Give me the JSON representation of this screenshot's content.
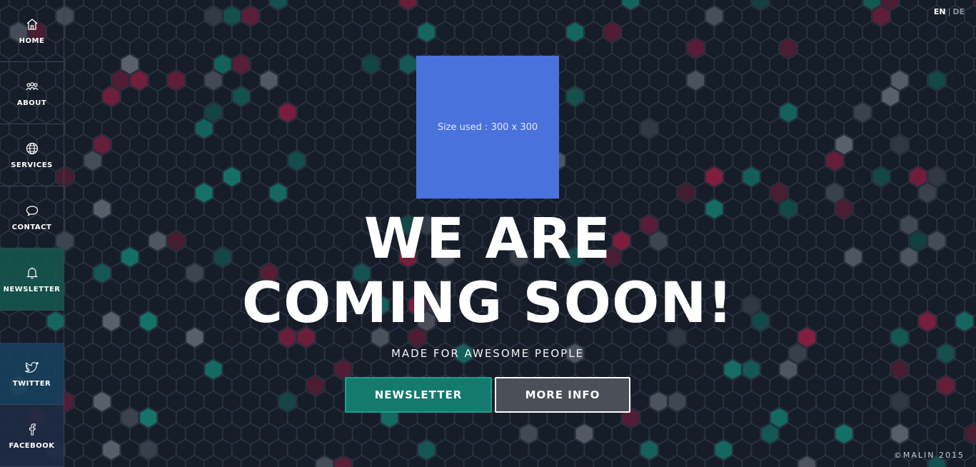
{
  "nav": [
    {
      "label": "HOME",
      "icon": "home-icon"
    },
    {
      "label": "ABOUT",
      "icon": "team-icon"
    },
    {
      "label": "SERVICES",
      "icon": "globe-icon"
    },
    {
      "label": "CONTACT",
      "icon": "chat-bubble-icon"
    },
    {
      "label": "NEWSLETTER",
      "icon": "bell-icon"
    },
    {
      "label": "TWITTER",
      "icon": "twitter-icon"
    },
    {
      "label": "FACEBOOK",
      "icon": "facebook-icon"
    }
  ],
  "lang": {
    "active": "EN",
    "separator": "|",
    "other": "DE"
  },
  "ad": {
    "text": "Size used : 300 x 300"
  },
  "hero": {
    "line1": "WE ARE",
    "line2": "COMING SOON!",
    "subtitle": "MADE FOR AWESOME PEOPLE"
  },
  "buttons": {
    "newsletter": "NEWSLETTER",
    "more_info": "MORE INFO"
  },
  "footer": {
    "copyright": "©MALIN 2015"
  },
  "colors": {
    "background": "#161d29",
    "teal": "#147a6e",
    "crimson": "#8a1f3f",
    "grey_hex": "#5e6570",
    "newsletter_panel": "#15584f",
    "twitter_panel": "#17405c",
    "facebook_panel": "#1e2a44",
    "ad_blue": "#4a72dc"
  }
}
